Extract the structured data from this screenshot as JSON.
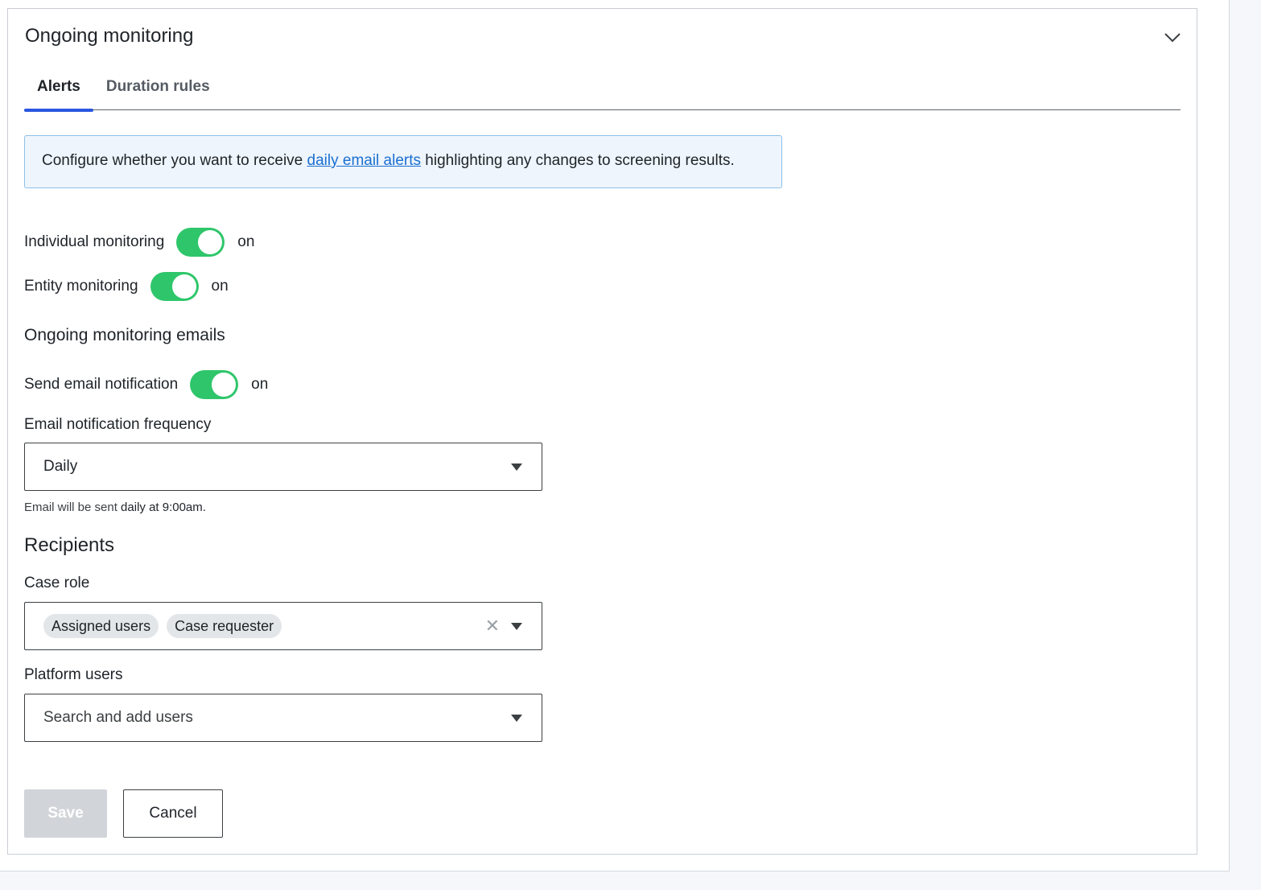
{
  "card": {
    "title": "Ongoing monitoring",
    "tabs": [
      {
        "label": "Alerts",
        "active": true
      },
      {
        "label": "Duration rules",
        "active": false
      }
    ]
  },
  "info": {
    "text_before": "Configure whether you want to receive ",
    "link_text": "daily email alerts",
    "text_after": " highlighting any changes to screening results."
  },
  "toggles": {
    "individual": {
      "label": "Individual monitoring",
      "state": "on"
    },
    "entity": {
      "label": "Entity monitoring",
      "state": "on"
    },
    "email": {
      "label": "Send email notification",
      "state": "on"
    }
  },
  "emails_heading": "Ongoing monitoring emails",
  "frequency": {
    "label": "Email notification frequency",
    "value": "Daily",
    "helper_prefix": "Email will be sent ",
    "helper_emphasis": "daily at 9:00am."
  },
  "recipients": {
    "heading": "Recipients",
    "case_role": {
      "label": "Case role",
      "chips": [
        "Assigned users",
        "Case requester"
      ]
    },
    "platform_users": {
      "label": "Platform users",
      "placeholder": "Search and add users"
    }
  },
  "actions": {
    "save_label": "Save",
    "cancel_label": "Cancel"
  },
  "colors": {
    "toggle_on": "#2fc66b",
    "tab_accent": "#2a56e0",
    "link": "#1b6fd1",
    "info_bg": "#eef5fc",
    "save_disabled_bg": "#d1d5d9"
  }
}
